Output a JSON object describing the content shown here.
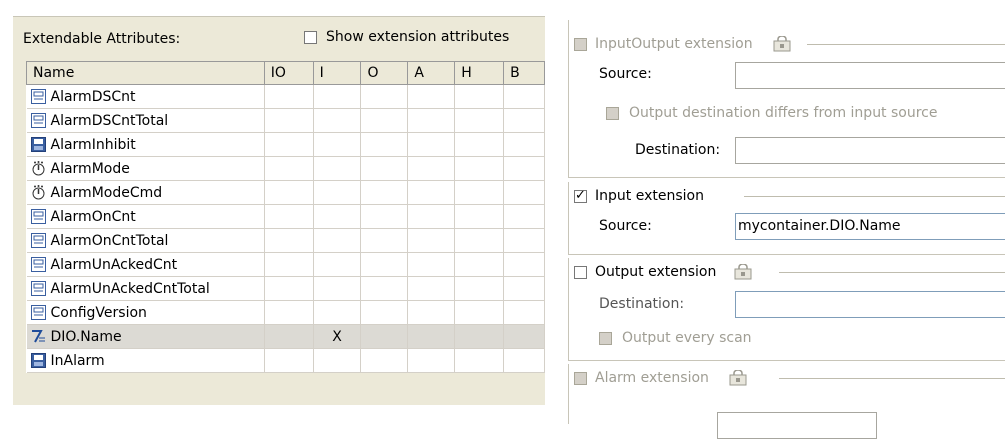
{
  "attributes_panel": {
    "title": "Extendable Attributes:",
    "show_extension_label": "Show extension attributes",
    "show_extension_checked": false,
    "columns": [
      "Name",
      "IO",
      "I",
      "O",
      "A",
      "H",
      "B"
    ],
    "rows": [
      {
        "name": "AlarmDSCnt",
        "icon": "int-icon",
        "io": "",
        "i": "",
        "o": "",
        "a": "",
        "h": "",
        "b": ""
      },
      {
        "name": "AlarmDSCntTotal",
        "icon": "int-icon",
        "io": "",
        "i": "",
        "o": "",
        "a": "",
        "h": "",
        "b": ""
      },
      {
        "name": "AlarmInhibit",
        "icon": "bool-icon",
        "io": "",
        "i": "",
        "o": "",
        "a": "",
        "h": "",
        "b": ""
      },
      {
        "name": "AlarmMode",
        "icon": "timer-icon",
        "io": "",
        "i": "",
        "o": "",
        "a": "",
        "h": "",
        "b": ""
      },
      {
        "name": "AlarmModeCmd",
        "icon": "timer-icon",
        "io": "",
        "i": "",
        "o": "",
        "a": "",
        "h": "",
        "b": ""
      },
      {
        "name": "AlarmOnCnt",
        "icon": "int-icon",
        "io": "",
        "i": "",
        "o": "",
        "a": "",
        "h": "",
        "b": ""
      },
      {
        "name": "AlarmOnCntTotal",
        "icon": "int-icon",
        "io": "",
        "i": "",
        "o": "",
        "a": "",
        "h": "",
        "b": ""
      },
      {
        "name": "AlarmUnAckedCnt",
        "icon": "int-icon",
        "io": "",
        "i": "",
        "o": "",
        "a": "",
        "h": "",
        "b": ""
      },
      {
        "name": "AlarmUnAckedCntTotal",
        "icon": "int-icon",
        "io": "",
        "i": "",
        "o": "",
        "a": "",
        "h": "",
        "b": ""
      },
      {
        "name": "ConfigVersion",
        "icon": "int-icon",
        "io": "",
        "i": "",
        "o": "",
        "a": "",
        "h": "",
        "b": ""
      },
      {
        "name": "DIO.Name",
        "icon": "string-icon",
        "io": "",
        "i": "X",
        "o": "",
        "a": "",
        "h": "",
        "b": "",
        "selected": true
      },
      {
        "name": "InAlarm",
        "icon": "bool-icon",
        "io": "",
        "i": "",
        "o": "",
        "a": "",
        "h": "",
        "b": ""
      }
    ]
  },
  "extensions": {
    "inputoutput": {
      "label": "InputOutput extension",
      "checked": false,
      "enabled": false,
      "source_label": "Source:",
      "source_value": "",
      "differs_label": "Output destination differs from input source",
      "differs_checked": false,
      "destination_label": "Destination:",
      "destination_value": ""
    },
    "input": {
      "label": "Input extension",
      "checked": true,
      "enabled": true,
      "source_label": "Source:",
      "source_value": "mycontainer.DIO.Name"
    },
    "output": {
      "label": "Output extension",
      "checked": false,
      "enabled": true,
      "destination_label": "Destination:",
      "destination_value": "",
      "every_scan_label": "Output every scan",
      "every_scan_checked": false
    },
    "alarm": {
      "label": "Alarm extension",
      "checked": false,
      "enabled": false
    }
  },
  "colors": {
    "panel_bg": "#ece9d8",
    "selected_row": "#dcdad4",
    "disabled_text": "#a09e94",
    "field_border": "#7f9db9"
  }
}
